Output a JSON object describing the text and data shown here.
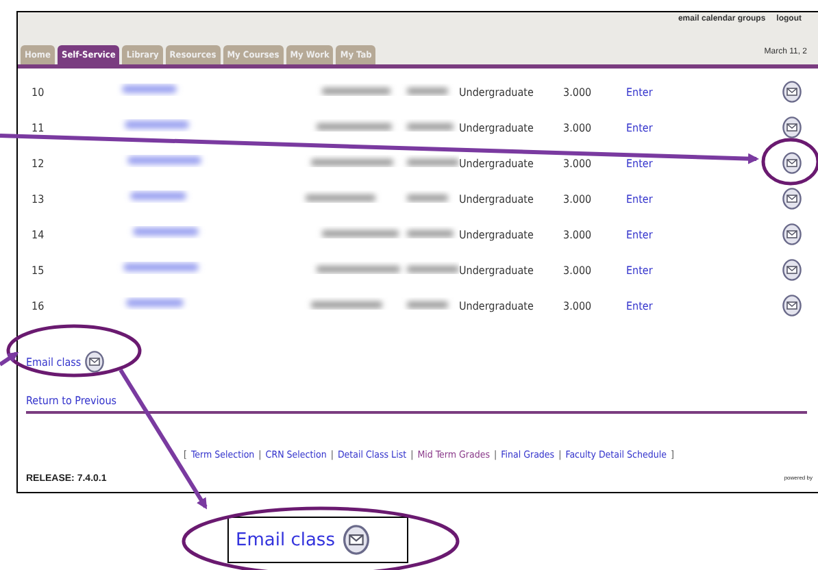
{
  "header": {
    "links": [
      "email calendar groups",
      "logout"
    ],
    "date": "March 11, 2"
  },
  "tabs": [
    {
      "label": "Home",
      "selected": false
    },
    {
      "label": "Self-Service",
      "selected": true
    },
    {
      "label": "Library",
      "selected": false
    },
    {
      "label": "Resources",
      "selected": false
    },
    {
      "label": "My Courses",
      "selected": false
    },
    {
      "label": "My Work",
      "selected": false
    },
    {
      "label": "My Tab",
      "selected": false
    }
  ],
  "rows": [
    {
      "number": "10",
      "level": "Undergraduate",
      "hours": "3.000",
      "action": "Enter",
      "highlighted": false
    },
    {
      "number": "11",
      "level": "Undergraduate",
      "hours": "3.000",
      "action": "Enter",
      "highlighted": false
    },
    {
      "number": "12",
      "level": "Undergraduate",
      "hours": "3.000",
      "action": "Enter",
      "highlighted": true
    },
    {
      "number": "13",
      "level": "Undergraduate",
      "hours": "3.000",
      "action": "Enter",
      "highlighted": false
    },
    {
      "number": "14",
      "level": "Undergraduate",
      "hours": "3.000",
      "action": "Enter",
      "highlighted": false
    },
    {
      "number": "15",
      "level": "Undergraduate",
      "hours": "3.000",
      "action": "Enter",
      "highlighted": false
    },
    {
      "number": "16",
      "level": "Undergraduate",
      "hours": "3.000",
      "action": "Enter",
      "highlighted": false
    }
  ],
  "email_link": "Email class",
  "return_link": "Return to Previous",
  "footer_links": [
    {
      "kind": "bracket",
      "label": "["
    },
    {
      "kind": "link",
      "label": "Term Selection",
      "selected": false
    },
    {
      "kind": "separator",
      "label": "|"
    },
    {
      "kind": "link",
      "label": "CRN Selection",
      "selected": false
    },
    {
      "kind": "separator",
      "label": "|"
    },
    {
      "kind": "link",
      "label": "Detail Class List",
      "selected": false
    },
    {
      "kind": "separator",
      "label": "|"
    },
    {
      "kind": "link",
      "label": "Mid Term Grades",
      "selected": true
    },
    {
      "kind": "separator",
      "label": "|"
    },
    {
      "kind": "link",
      "label": "Final Grades",
      "selected": false
    },
    {
      "kind": "separator",
      "label": "|"
    },
    {
      "kind": "link",
      "label": "Faculty Detail Schedule",
      "selected": false
    },
    {
      "kind": "bracket",
      "label": "]"
    }
  ],
  "release": "RELEASE: 7.4.0.1",
  "powered_by": "powered by",
  "callout": {
    "label": "Email class"
  }
}
